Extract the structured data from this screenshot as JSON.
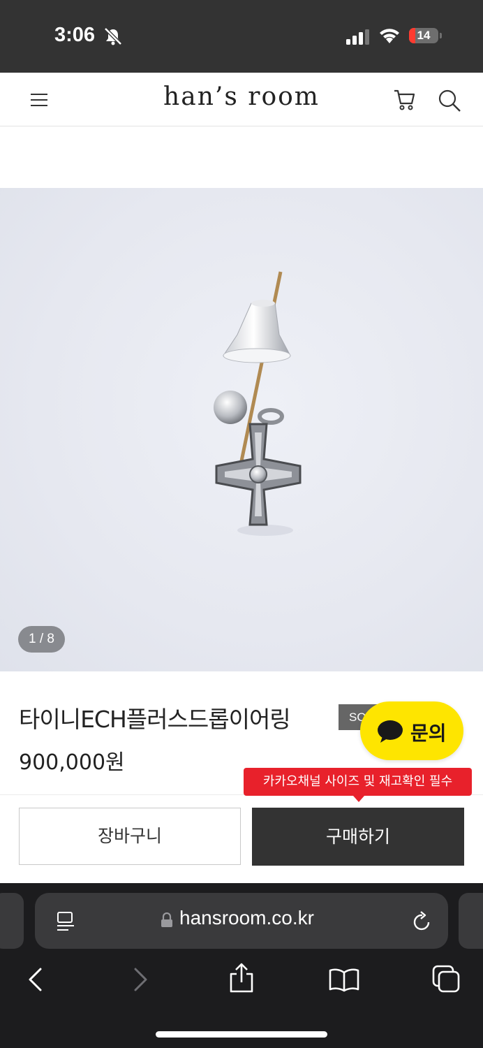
{
  "status_bar": {
    "time": "3:06",
    "battery": "14",
    "battery_level": 0.14
  },
  "header": {
    "logo": "han’s room"
  },
  "product": {
    "image_counter": "1 / 8",
    "name": "타이니ECH플러스드롭이어링",
    "badge": "SOLD OUT",
    "price": "900,000원"
  },
  "kakao": {
    "label": "문의",
    "notice": "카카오채널 사이즈 및 재고확인 필수"
  },
  "actions": {
    "cart_label": "장바구니",
    "buy_label": "구매하기"
  },
  "browser": {
    "url": "hansroom.co.kr"
  },
  "colors": {
    "status_bar_bg": "#333333",
    "kakao_yellow": "#fee500",
    "notice_red": "#e8212b",
    "buy_button_bg": "#333333",
    "browser_bg": "#1c1c1e"
  },
  "icons": [
    "bell-slash-icon",
    "cellular-signal-icon",
    "wifi-icon",
    "battery-icon",
    "hamburger-menu-icon",
    "cart-icon",
    "search-icon",
    "chat-bubble-icon",
    "reader-mode-icon",
    "lock-icon",
    "reload-icon",
    "back-arrow-icon",
    "forward-arrow-icon",
    "share-icon",
    "bookmarks-icon",
    "tabs-icon"
  ]
}
